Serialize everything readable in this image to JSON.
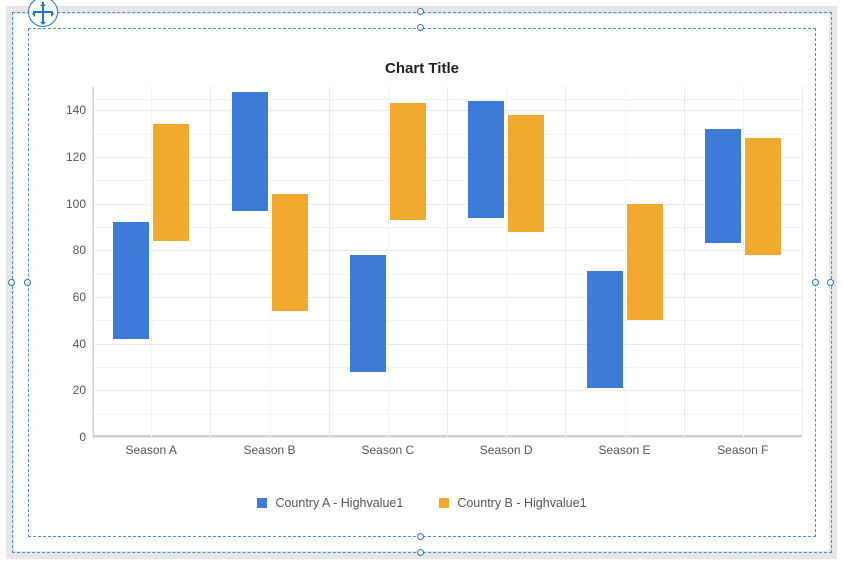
{
  "chart_data": {
    "type": "bar",
    "title": "Chart Title",
    "xlabel": "",
    "ylabel": "",
    "ylim": [
      0,
      150
    ],
    "yticks": [
      0,
      20,
      40,
      60,
      80,
      100,
      120,
      140
    ],
    "categories": [
      "Season A",
      "Season B",
      "Season C",
      "Season D",
      "Season E",
      "Season F"
    ],
    "series": [
      {
        "name": "Country A - Highvalue1",
        "color": "#3d7bd9",
        "ranges": [
          {
            "low": 42,
            "high": 92
          },
          {
            "low": 97,
            "high": 148
          },
          {
            "low": 28,
            "high": 78
          },
          {
            "low": 94,
            "high": 144
          },
          {
            "low": 21,
            "high": 71
          },
          {
            "low": 83,
            "high": 132
          }
        ]
      },
      {
        "name": "Country B - Highvalue1",
        "color": "#f0a92e",
        "ranges": [
          {
            "low": 84,
            "high": 134
          },
          {
            "low": 54,
            "high": 104
          },
          {
            "low": 93,
            "high": 143
          },
          {
            "low": 88,
            "high": 138
          },
          {
            "low": 50,
            "high": 100
          },
          {
            "low": 78,
            "high": 128
          }
        ]
      }
    ]
  },
  "legend": {
    "items": [
      {
        "label": "Country A - Highvalue1"
      },
      {
        "label": "Country B - Highvalue1"
      }
    ]
  }
}
